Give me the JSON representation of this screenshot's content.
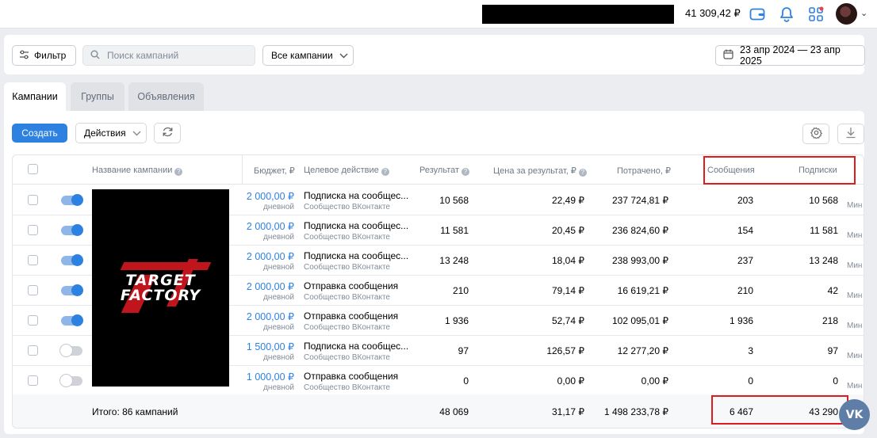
{
  "topbar": {
    "balance": "41 309,42 ₽",
    "icons": [
      "wallet-icon",
      "bell-icon",
      "apps-icon",
      "avatar"
    ]
  },
  "filters": {
    "filter_label": "Фильтр",
    "search_placeholder": "Поиск кампаний",
    "campaigns_select": "Все кампании",
    "date_range": "23 апр 2024 — 23 апр 2025"
  },
  "tabs": [
    "Кампании",
    "Группы",
    "Объявления"
  ],
  "toolbar": {
    "create_label": "Создать",
    "actions_label": "Действия"
  },
  "table": {
    "headers": {
      "name": "Название кампании",
      "budget": "Бюджет, ₽",
      "target": "Целевое действие",
      "result": "Результат",
      "cost_per_result": "Цена за результат, ₽",
      "spent": "Потрачено, ₽",
      "messages": "Сообщения",
      "subscriptions": "Подписки",
      "cut_off": "Мин"
    },
    "budget_period": "дневной",
    "target_sub": "Сообщество ВКонтакте",
    "logo_text": [
      "TARGET",
      "FACTORY"
    ],
    "rows": [
      {
        "on": true,
        "budget": "2 000,00 ₽",
        "target": "Подписка на сообщес...",
        "result": "10 568",
        "cpr": "22,49 ₽",
        "spent": "237 724,81 ₽",
        "messages": "203",
        "subs": "10 568"
      },
      {
        "on": true,
        "budget": "2 000,00 ₽",
        "target": "Подписка на сообщес...",
        "result": "11 581",
        "cpr": "20,45 ₽",
        "spent": "236 824,60 ₽",
        "messages": "154",
        "subs": "11 581"
      },
      {
        "on": true,
        "budget": "2 000,00 ₽",
        "target": "Подписка на сообщес...",
        "result": "13 248",
        "cpr": "18,04 ₽",
        "spent": "238 993,00 ₽",
        "messages": "237",
        "subs": "13 248"
      },
      {
        "on": true,
        "budget": "2 000,00 ₽",
        "target": "Отправка сообщения",
        "result": "210",
        "cpr": "79,14 ₽",
        "spent": "16 619,21 ₽",
        "messages": "210",
        "subs": "42"
      },
      {
        "on": true,
        "budget": "2 000,00 ₽",
        "target": "Отправка сообщения",
        "result": "1 936",
        "cpr": "52,74 ₽",
        "spent": "102 095,01 ₽",
        "messages": "1 936",
        "subs": "218"
      },
      {
        "on": false,
        "budget": "1 500,00 ₽",
        "target": "Подписка на сообщес...",
        "result": "97",
        "cpr": "126,57 ₽",
        "spent": "12 277,20 ₽",
        "messages": "3",
        "subs": "97"
      },
      {
        "on": false,
        "budget": "1 000,00 ₽",
        "target": "Отправка сообщения",
        "result": "0",
        "cpr": "0,00 ₽",
        "spent": "0,00 ₽",
        "messages": "0",
        "subs": "0"
      }
    ],
    "totals": {
      "label": "Итого: 86 кампаний",
      "result": "48 069",
      "cpr": "31,17 ₽",
      "spent": "1 498 233,78 ₽",
      "messages": "6 467",
      "subs": "43 290"
    }
  },
  "colors": {
    "accent": "#2d81e0",
    "highlight": "#e01b1b"
  },
  "fab_label": "VK"
}
